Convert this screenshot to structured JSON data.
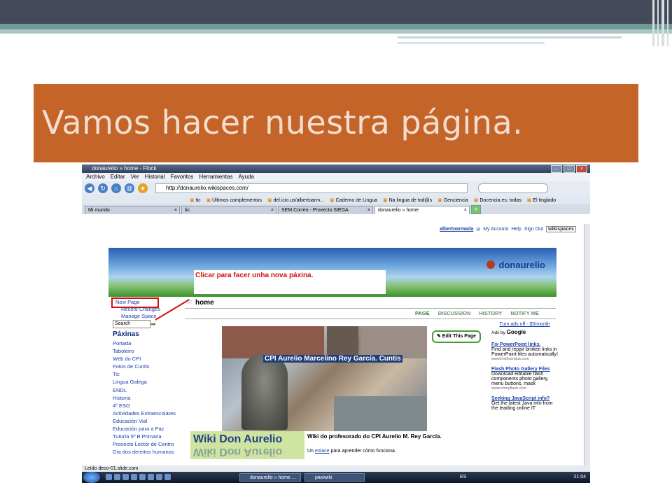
{
  "slide": {
    "title": "Vamos hacer nuestra página."
  },
  "browser": {
    "window_title": "donaurelio » home - Flock",
    "menu": [
      "Archivo",
      "Editar",
      "Ver",
      "Historial",
      "Favoritos",
      "Herramientas",
      "Ayuda"
    ],
    "url": "http://donaurelio.wikispaces.com/",
    "bookmarks": [
      "tic",
      "Últimos complementos",
      "del.icio.us/albertoarm...",
      "Caderno de Lingua",
      "Na lingua de tod@s",
      "Genciencia",
      "Docencia.es: todas",
      "El tinglado"
    ],
    "tabs": [
      "Mi mundo",
      "tic",
      "SEM Correo - Proxecto SIEGA",
      "donaurelio » home"
    ],
    "status": "Leído deco-01.slide.com"
  },
  "userbar": {
    "user": "albertoarmada",
    "links": [
      "My Account",
      "Help",
      "Sign Out"
    ],
    "logo": "wikispaces"
  },
  "site": {
    "name": "donaurelio",
    "callout": "Clicar para facer unha nova páxina.",
    "sidebar": {
      "new_page": "New Page",
      "recent_changes": "Recent Changes",
      "manage_space": "Manage Space",
      "search_label": "Search",
      "nav_heading": "Páxinas",
      "nav_items": [
        "Portada",
        "Taboleiro",
        "Web do CPI",
        "Fotos de Cuntis",
        "Tic",
        "Lingua Galega",
        "ENDL",
        "Historia",
        "4º ESO",
        "Actividades Extraescolares",
        "Educación Vial",
        "Educación para a Paz",
        "Tutoría 5º B Primaria",
        "Proxecto Lector de Centro",
        "Día dos dereitos humanos"
      ]
    },
    "page_title": "home",
    "page_tabs": [
      "PAGE",
      "DISCUSSION",
      "HISTORY",
      "NOTIFY ME"
    ],
    "edit_button": "Edit This Page",
    "photo_caption": "CPI Aurelio Marcelino Rey García. Cuntis",
    "wiki_logo": "Wiki Don Aurelio",
    "caption_line1": "Wiki do profesorado do CPI Aurelio M. Rey García.",
    "caption_line2_pre": "Un",
    "caption_line2_link": "enlace",
    "caption_line2_post": "para aprender cómo funciona.",
    "ads": {
      "turn_off": "Turn ads off - $5/month",
      "ads_by": "Ads by",
      "google": "Google",
      "items": [
        {
          "title": "Fix PowerPoint links.",
          "body": "Find and repair broken links in PowerPoint files automatically!",
          "url": "www.linkfixerplus.com"
        },
        {
          "title": "Flash Photo Gallery Files",
          "body": "Download editable flash components photo gallery, menu buttons, mask",
          "url": "www.ohmyflash.com"
        },
        {
          "title": "Seeking JavaScript info?",
          "body": "Get the latest Java info from the leading online IT",
          "url": ""
        }
      ]
    }
  },
  "taskbar": {
    "tasks": [
      "donaurelio » home ...",
      "paxiwiki"
    ],
    "lang": "ES",
    "clock": "21:04"
  }
}
